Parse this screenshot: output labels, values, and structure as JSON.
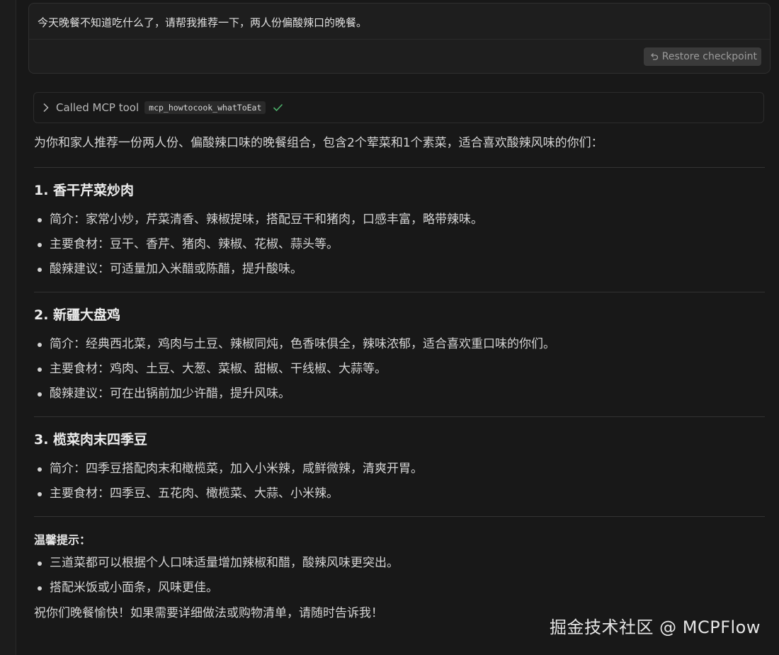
{
  "user_message": {
    "text": "今天晚餐不知道吃什么了，请帮我推荐一下，两人份偏酸辣口的晚餐。",
    "restore_label": "Restore checkpoint"
  },
  "tool_call": {
    "label": "Called MCP tool",
    "tool_name": "mcp_howtocook_whatToEat"
  },
  "response": {
    "intro": "为你和家人推荐一份两人份、偏酸辣口味的晚餐组合，包含2个荤菜和1个素菜，适合喜欢酸辣风味的你们：",
    "dishes": [
      {
        "title": "1. 香干芹菜炒肉",
        "items": [
          "简介：家常小炒，芹菜清香、辣椒提味，搭配豆干和猪肉，口感丰富，略带辣味。",
          "主要食材：豆干、香芹、猪肉、辣椒、花椒、蒜头等。",
          "酸辣建议：可适量加入米醋或陈醋，提升酸味。"
        ]
      },
      {
        "title": "2. 新疆大盘鸡",
        "items": [
          "简介：经典西北菜，鸡肉与土豆、辣椒同炖，色香味俱全，辣味浓郁，适合喜欢重口味的你们。",
          "主要食材：鸡肉、土豆、大葱、菜椒、甜椒、干线椒、大蒜等。",
          "酸辣建议：可在出锅前加少许醋，提升风味。"
        ]
      },
      {
        "title": "3. 榄菜肉末四季豆",
        "items": [
          "简介：四季豆搭配肉末和橄榄菜，加入小米辣，咸鲜微辣，清爽开胃。",
          "主要食材：四季豆、五花肉、橄榄菜、大蒜、小米辣。"
        ]
      }
    ],
    "tips_title": "温馨提示：",
    "tips": [
      "三道菜都可以根据个人口味适量增加辣椒和醋，酸辣风味更突出。",
      "搭配米饭或小面条，风味更佳。"
    ],
    "closing": "祝你们晚餐愉快！如果需要详细做法或购物清单，请随时告诉我！"
  },
  "watermark": "掘金技术社区 @ MCPFlow"
}
